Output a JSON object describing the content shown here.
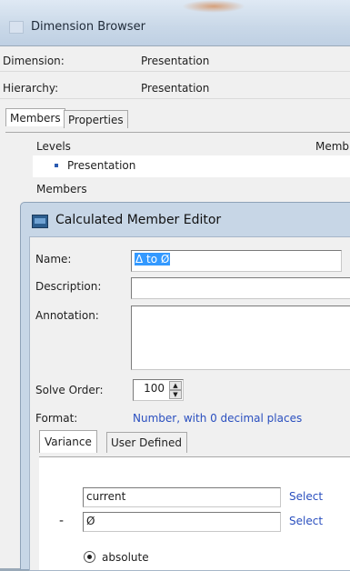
{
  "outer_window": {
    "title": "Dimension Browser",
    "dimension_label": "Dimension:",
    "dimension_value": "Presentation",
    "hierarchy_label": "Hierarchy:",
    "hierarchy_value": "Presentation",
    "tabs": [
      "Members",
      "Properties"
    ],
    "levels_header": "Levels",
    "members_col_header": "Memb",
    "level_item": "Presentation",
    "members_section": "Members"
  },
  "dialog": {
    "title": "Calculated Member Editor",
    "name_label": "Name:",
    "name_value": "Δ to Ø",
    "description_label": "Description:",
    "description_value": "",
    "annotation_label": "Annotation:",
    "annotation_value": "",
    "solve_order_label": "Solve Order:",
    "solve_order_value": "100",
    "format_label": "Format:",
    "format_value": "Number, with 0 decimal places",
    "tabs": [
      "Variance",
      "User Defined"
    ],
    "operand1_value": "current",
    "operand2_value": "Ø",
    "minus_sign": "-",
    "select_label": "Select",
    "radio_absolute_label": "absolute"
  },
  "icons": {
    "window_icon": "app-window-icon",
    "dialog_icon": "calculator-icon",
    "bullet": "bullet-icon"
  },
  "colors": {
    "selection": "#3399ff",
    "link": "#2a4fbf",
    "titlebar": "#c7d6e6"
  }
}
